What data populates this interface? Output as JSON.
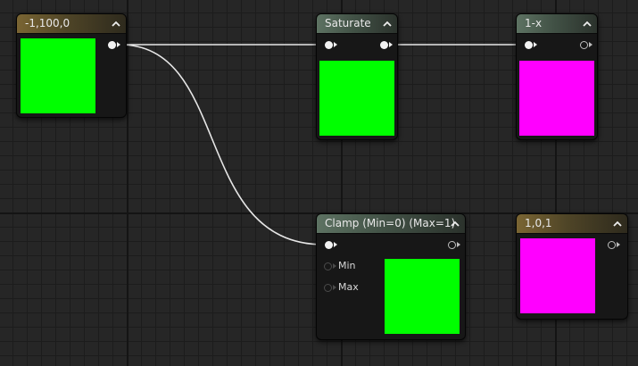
{
  "nodes": {
    "constant3": {
      "title": "-1,100,0",
      "preview_color": "#00ff00"
    },
    "saturate": {
      "title": "Saturate",
      "preview_color": "#00ff00"
    },
    "one_minus": {
      "title": "1-x",
      "preview_color": "#ff00ff"
    },
    "clamp": {
      "title": "Clamp (Min=0) (Max=1)",
      "preview_color": "#00ff00",
      "inputs": {
        "min": "Min",
        "max": "Max"
      }
    },
    "constant_101": {
      "title": "1,0,1",
      "preview_color": "#ff00ff"
    }
  },
  "colors": {
    "constant_header": "#7a6533",
    "function_header": "#5d7262",
    "wire": "#e6e6e6",
    "grid_background": "#262626"
  },
  "icons": {
    "collapse": "chevron-up-icon"
  }
}
